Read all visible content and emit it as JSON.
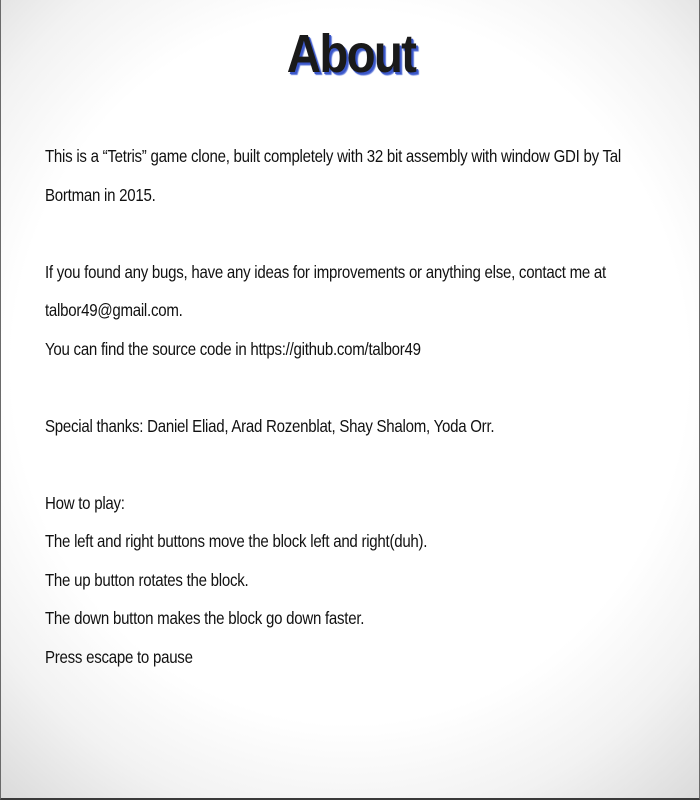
{
  "title": "About",
  "paragraphs": {
    "intro_line1": "This is a “Tetris” game clone, built completely with 32 bit assembly with window GDI by Tal",
    "intro_line2": "Bortman in 2015.",
    "contact_line1": "If you found any bugs, have any ideas for improvements or anything else, contact me at",
    "contact_line2": "talbor49@gmail.com.",
    "source_line": "You can find the source code in https://github.com/talbor49",
    "thanks_line": "Special thanks: Daniel Eliad, Arad Rozenblat, Shay Shalom, Yoda Orr."
  },
  "how_to_play": {
    "heading": "How to play:",
    "lines": [
      "The left and right buttons move the block left and right(duh).",
      "The up button rotates the block.",
      "The down button makes the block go down faster.",
      "Press escape to pause"
    ]
  },
  "colors": {
    "title_shadow": "#3b57c9",
    "text": "#111111",
    "background": "#ffffff"
  }
}
